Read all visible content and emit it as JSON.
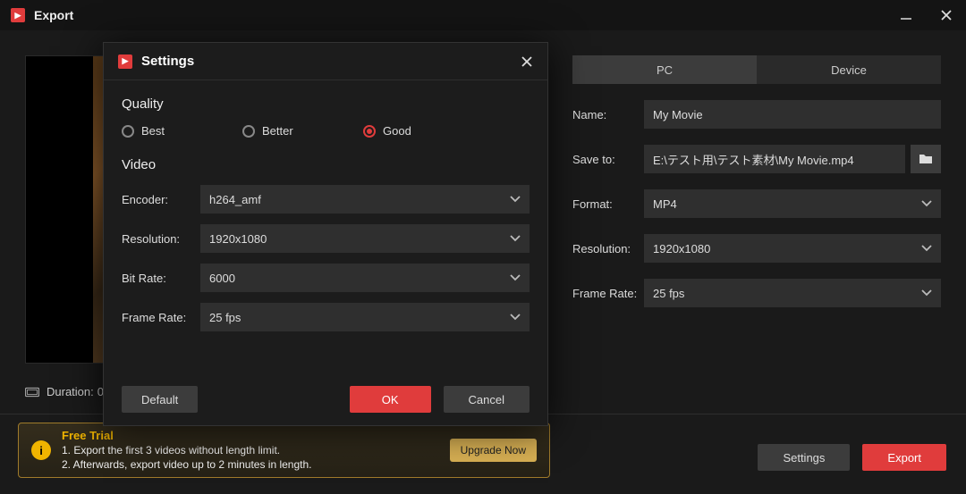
{
  "titlebar": {
    "title": "Export"
  },
  "preview": {
    "duration_label": "Duration:",
    "duration_value": "0"
  },
  "tabs": {
    "pc": "PC",
    "device": "Device"
  },
  "form": {
    "name_label": "Name:",
    "name_value": "My Movie",
    "save_label": "Save to:",
    "save_value": "E:\\テスト用\\テスト素材\\My Movie.mp4",
    "format_label": "Format:",
    "format_value": "MP4",
    "resolution_label": "Resolution:",
    "resolution_value": "1920x1080",
    "framerate_label": "Frame Rate:",
    "framerate_value": "25 fps"
  },
  "banner": {
    "heading": "Free Trial",
    "line1": "1. Export the first 3 videos without length limit.",
    "line2": "2. Afterwards, export video up to 2 minutes in length.",
    "upgrade": "Upgrade Now"
  },
  "buttons": {
    "settings": "Settings",
    "export": "Export"
  },
  "modal": {
    "title": "Settings",
    "quality_label": "Quality",
    "quality_options": {
      "best": "Best",
      "better": "Better",
      "good": "Good"
    },
    "video_label": "Video",
    "encoder_label": "Encoder:",
    "encoder_value": "h264_amf",
    "resolution_label": "Resolution:",
    "resolution_value": "1920x1080",
    "bitrate_label": "Bit Rate:",
    "bitrate_value": "6000",
    "framerate_label": "Frame Rate:",
    "framerate_value": "25 fps",
    "default": "Default",
    "ok": "OK",
    "cancel": "Cancel"
  }
}
